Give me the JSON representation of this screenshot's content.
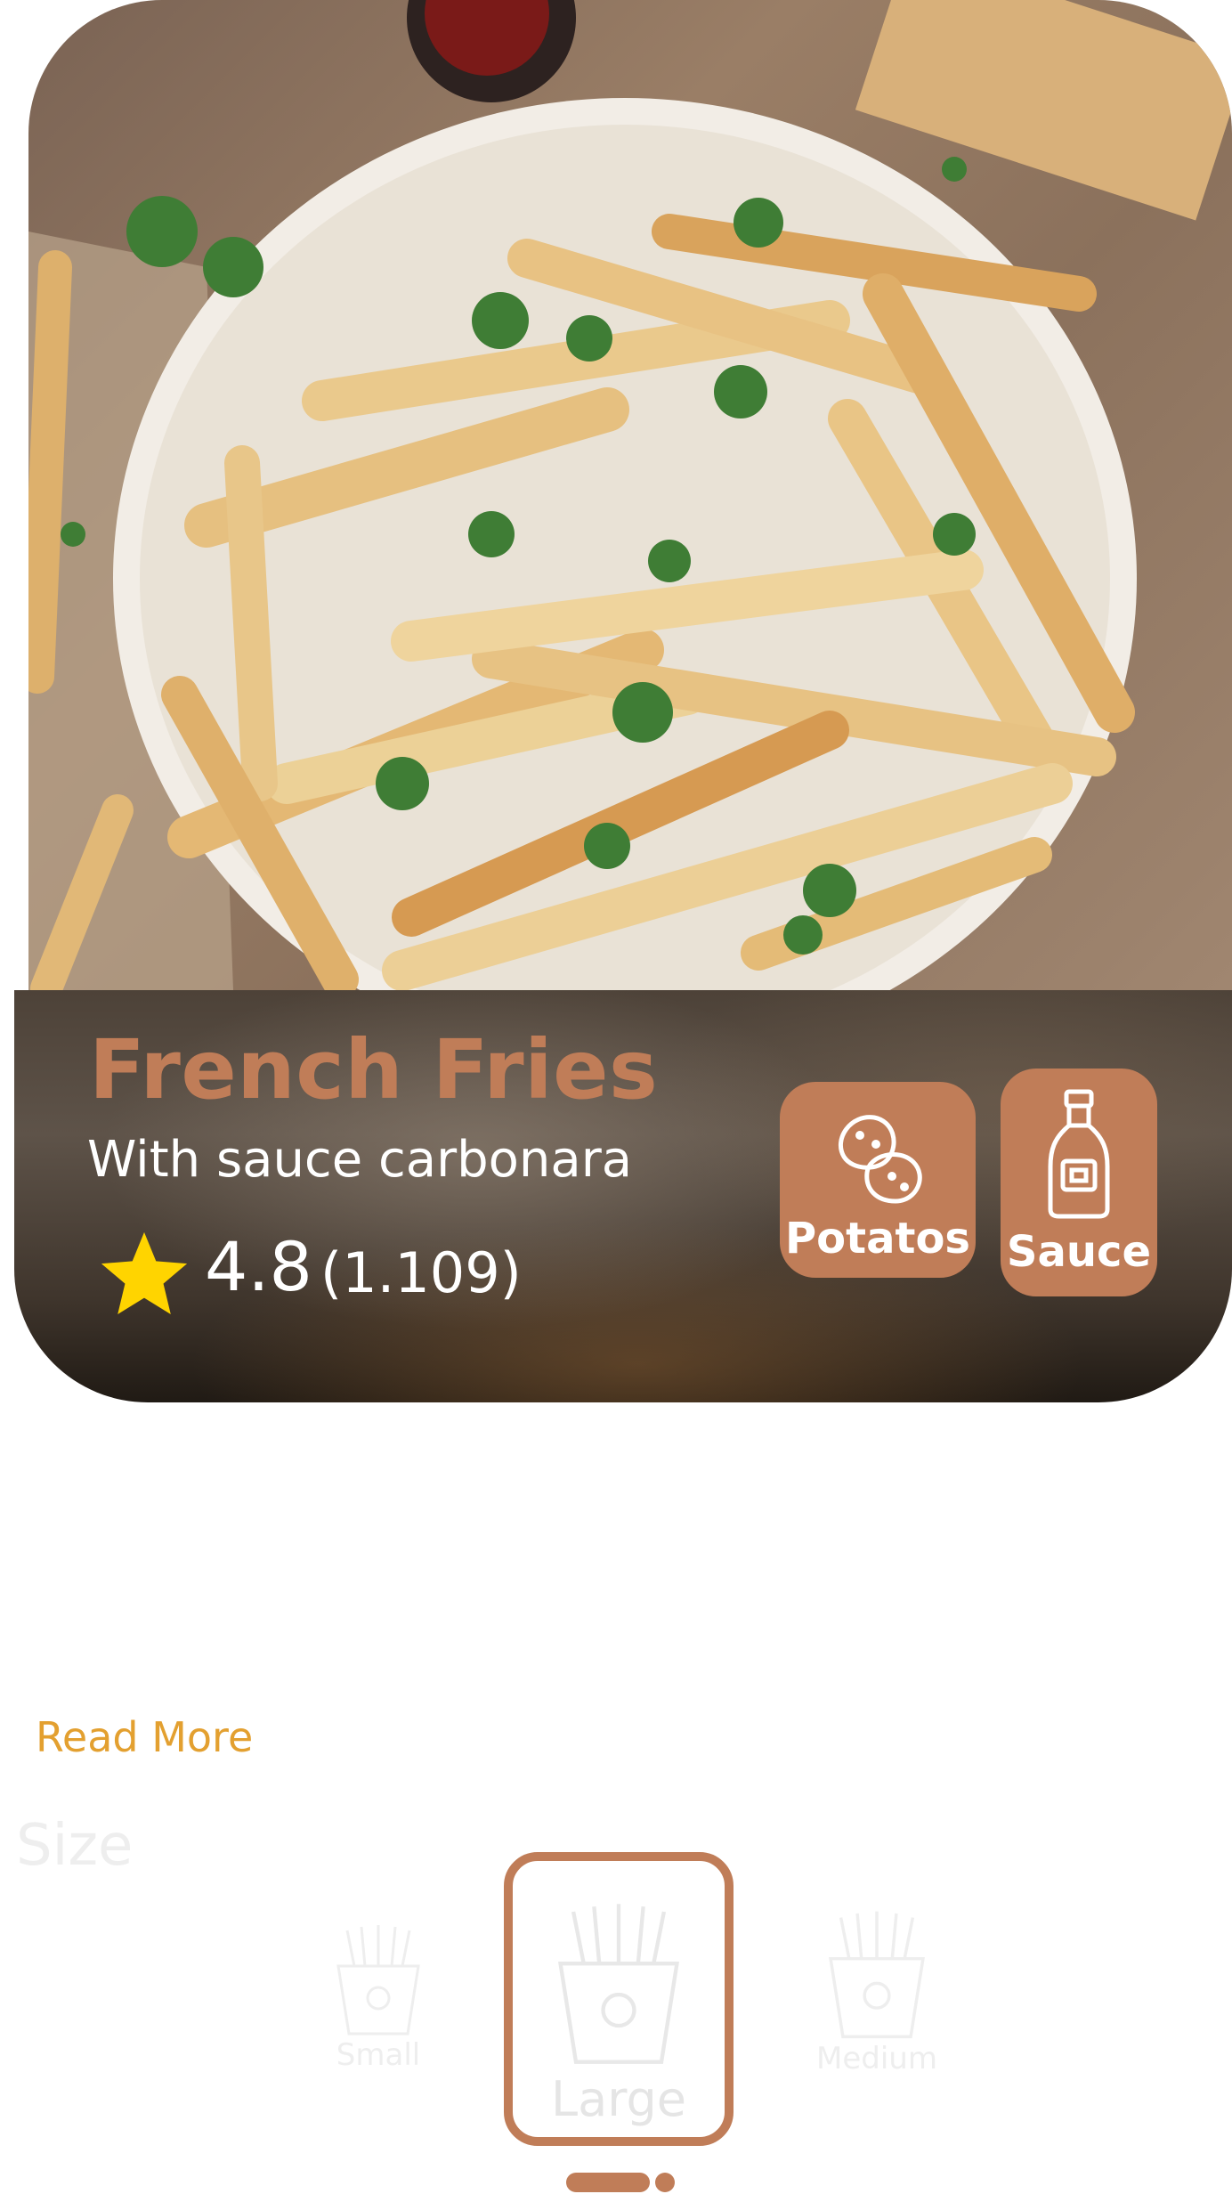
{
  "product": {
    "name": "French Fries",
    "subtitle": "With sauce carbonara",
    "rating": "4.8",
    "review_count": "(1.109)"
  },
  "ingredients": [
    {
      "label": "Potatos",
      "icon": "potato-icon"
    },
    {
      "label": "Sauce",
      "icon": "sauce-bottle-icon"
    }
  ],
  "read_more_label": "Read More",
  "size_section": {
    "heading": "Size",
    "options": [
      {
        "label": "Small",
        "icon": "fries-icon"
      },
      {
        "label": "Large",
        "icon": "fries-icon",
        "selected": true
      },
      {
        "label": "Medium",
        "icon": "fries-icon"
      }
    ]
  },
  "colors": {
    "accent": "#c07d58",
    "star": "#ffd400",
    "read_more": "#e3a030",
    "muted": "#eeeeee"
  }
}
